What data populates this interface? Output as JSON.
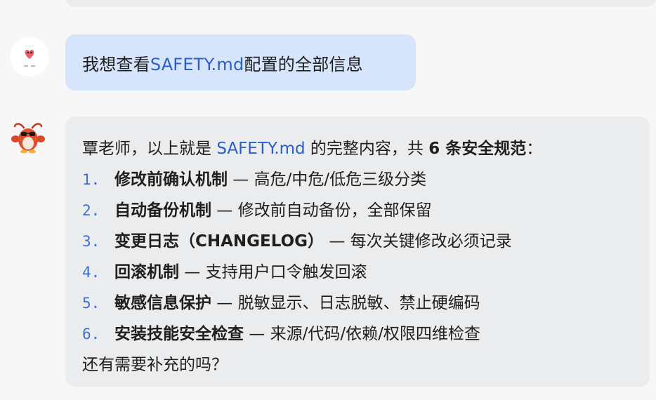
{
  "user_message": {
    "before": "我想查看",
    "highlight": "SAFETY.md",
    "after": "配置的全部信息"
  },
  "assistant_message": {
    "intro_before": "覃老师，以上就是 ",
    "intro_file": "SAFETY.md",
    "intro_middle": " 的完整内容，共 ",
    "intro_bold": "6 条安全规范",
    "intro_end": "：",
    "items": [
      {
        "num": "1.",
        "title": "修改前确认机制",
        "desc": " — 高危/中危/低危三级分类"
      },
      {
        "num": "2.",
        "title": "自动备份机制",
        "desc": " — 修改前自动备份，全部保留"
      },
      {
        "num": "3.",
        "title": "变更日志（CHANGELOG）",
        "desc": " — 每次关键修改必须记录"
      },
      {
        "num": "4.",
        "title": "回滚机制",
        "desc": " — 支持用户口令触发回滚"
      },
      {
        "num": "5.",
        "title": "敏感信息保护",
        "desc": " — 脱敏显示、日志脱敏、禁止硬编码"
      },
      {
        "num": "6.",
        "title": "安装技能安全检查",
        "desc": " — 来源/代码/依赖/权限四维检查"
      }
    ],
    "closing": "还有需要补充的吗？"
  },
  "icons": {
    "user_avatar": "user-avatar-icon",
    "assistant_avatar": "lobster-mascot-icon"
  },
  "colors": {
    "user_bubble": "#d6e5fc",
    "assistant_bubble": "#ebecee",
    "link": "#2b5fc7",
    "list_number": "#3e6fd0"
  }
}
